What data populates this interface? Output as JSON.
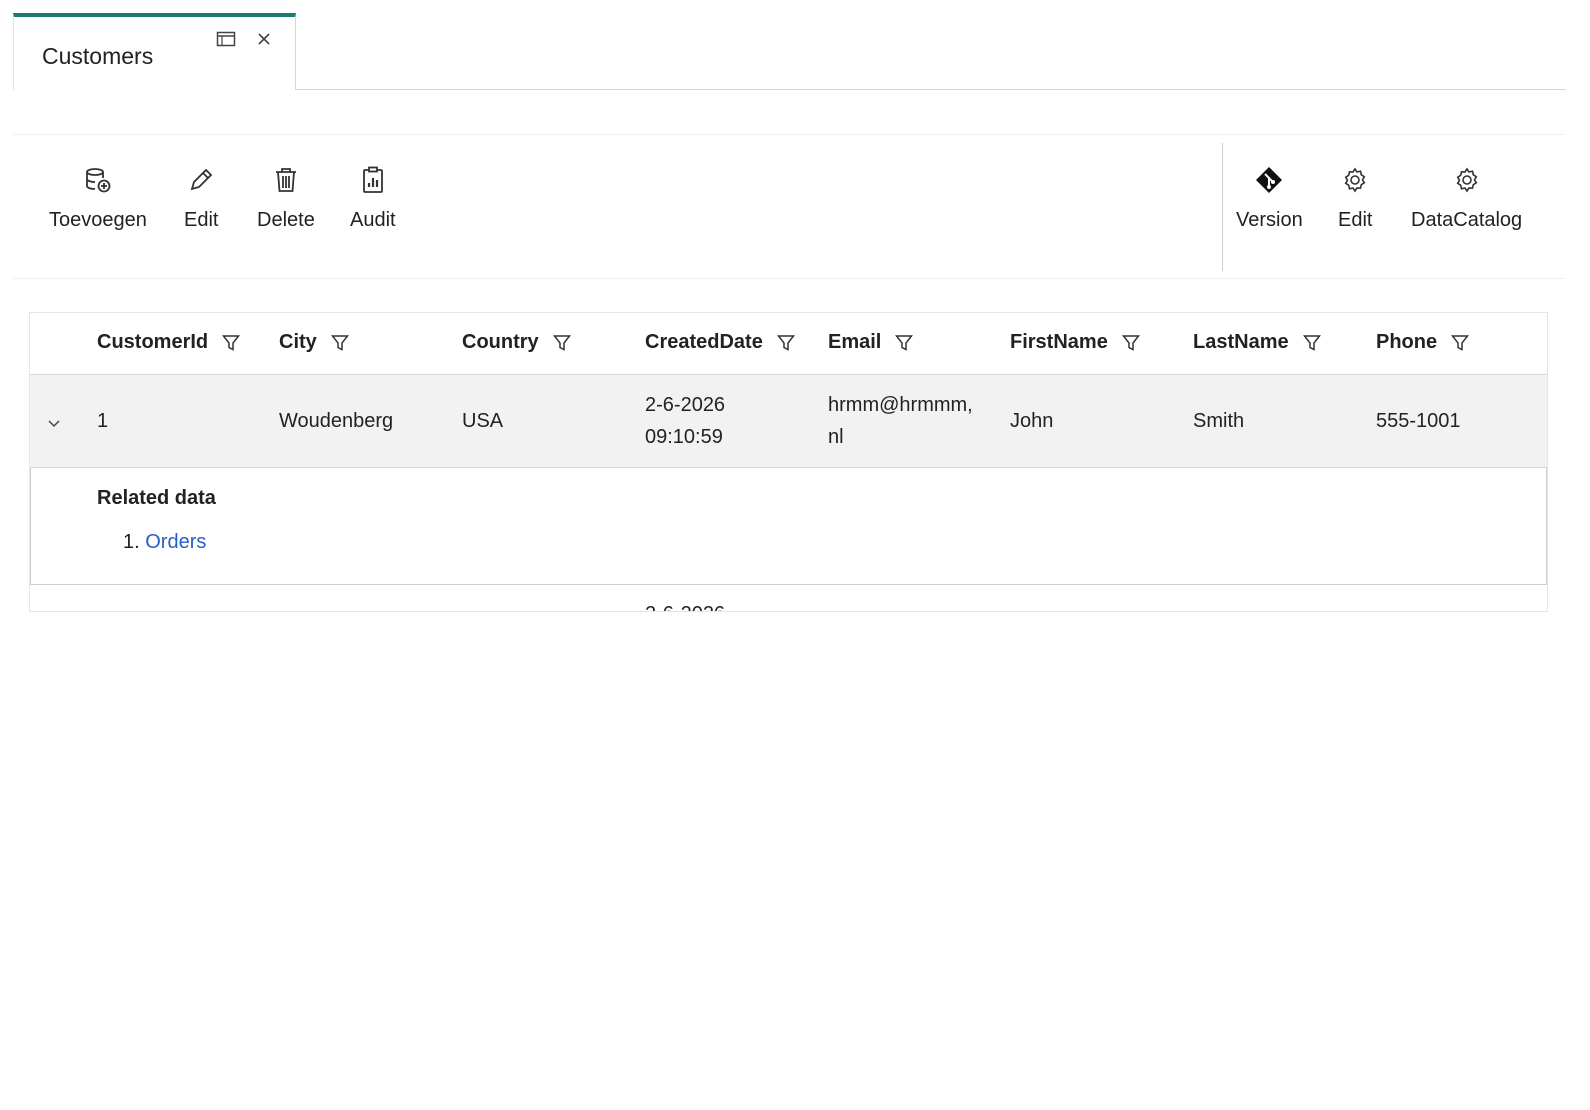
{
  "tab": {
    "title": "Customers"
  },
  "toolbar": {
    "left": [
      {
        "label": "Toevoegen",
        "icon": "database-add-icon"
      },
      {
        "label": "Edit",
        "icon": "pencil-icon"
      },
      {
        "label": "Delete",
        "icon": "trash-icon"
      },
      {
        "label": "Audit",
        "icon": "clipboard-chart-icon"
      }
    ],
    "right": [
      {
        "label": "Version",
        "icon": "git-diamond-icon"
      },
      {
        "label": "Edit",
        "icon": "gear-icon"
      },
      {
        "label": "DataCatalog",
        "icon": "gear-icon"
      }
    ]
  },
  "grid": {
    "columns": [
      "CustomerId",
      "City",
      "Country",
      "CreatedDate",
      "Email",
      "FirstName",
      "LastName",
      "Phone"
    ],
    "rows": [
      {
        "customer_id": "1",
        "city": "Woudenberg",
        "country": "USA",
        "created_date_1": "2-6-2026",
        "created_date_2": "09:10:59",
        "email_1": "hrmm@hrmmm,",
        "email_2": "nl",
        "first_name": "John",
        "last_name": "Smith",
        "phone": "555-1001"
      }
    ],
    "related": {
      "title": "Related data",
      "items": [
        {
          "number": "1.",
          "label": "Orders"
        }
      ]
    },
    "next_row_peek": "2-6-2026"
  }
}
